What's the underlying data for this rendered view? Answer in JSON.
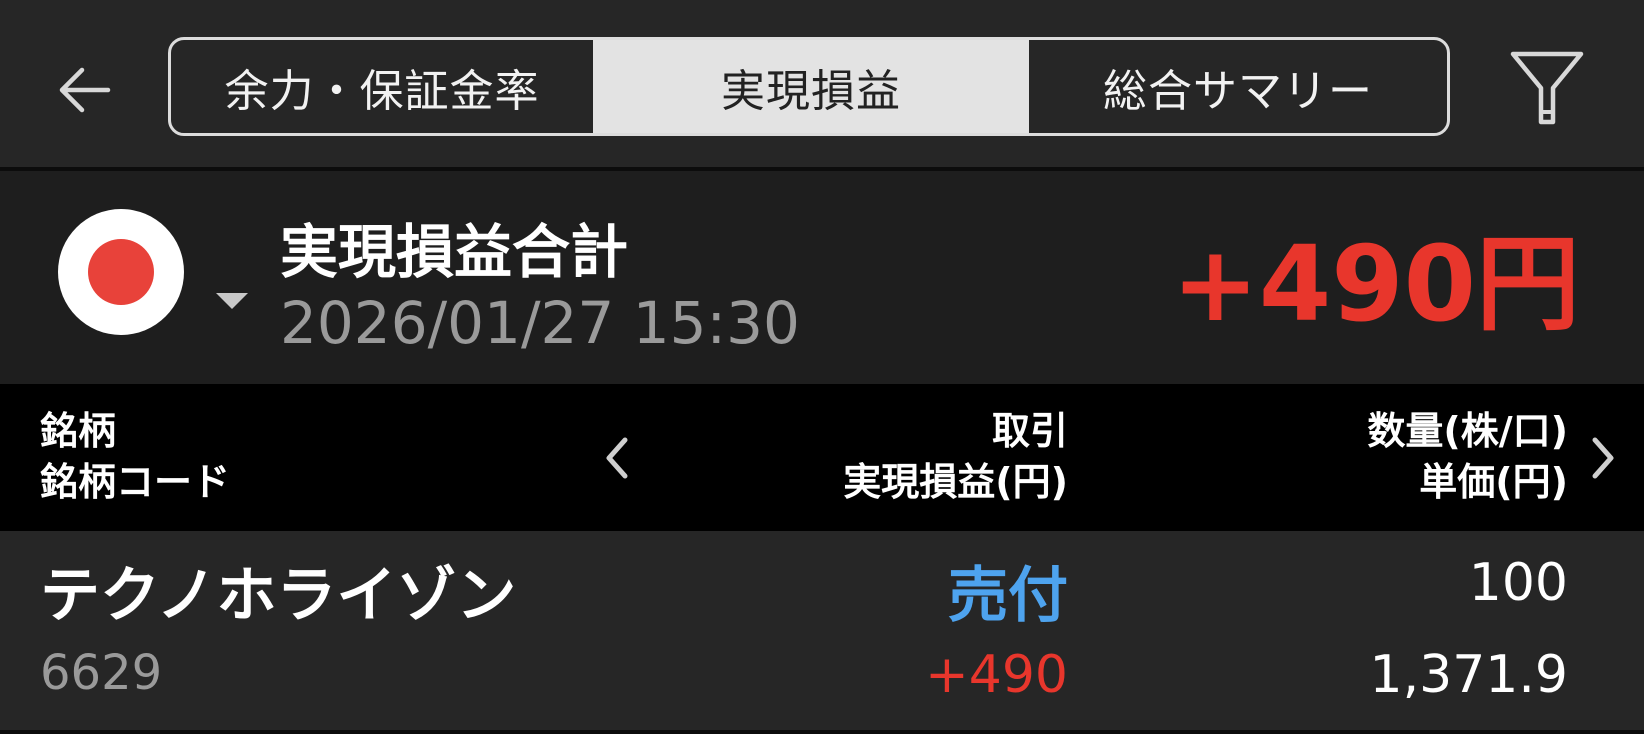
{
  "header": {
    "tabs": [
      {
        "label": "余力・保証金率",
        "selected": false
      },
      {
        "label": "実現損益",
        "selected": true
      },
      {
        "label": "総合サマリー",
        "selected": false
      }
    ],
    "back_icon": "arrow-left-icon",
    "filter_icon": "filter-icon"
  },
  "summary": {
    "market_icon": "japan-flag-icon",
    "title": "実現損益合計",
    "datetime": "2026/01/27  15:30",
    "total": "+490円"
  },
  "table": {
    "columns": {
      "col1": [
        "銘柄",
        "銘柄コード"
      ],
      "col2": [
        "取引",
        "実現損益(円)"
      ],
      "col3": [
        "数量(株/口)",
        "単価(円)"
      ]
    },
    "rows": [
      {
        "name": "テクノホライゾン",
        "code": "6629",
        "trade": "売付",
        "pl": "+490",
        "qty": "100",
        "price": "1,371.9"
      }
    ]
  },
  "colors": {
    "background": "#1e1e1e",
    "bar": "#262626",
    "header_bg": "#000000",
    "selected_tab": "#e3e3e3",
    "positive_red": "#e8362c",
    "sell_blue": "#4ea3ee",
    "muted_text": "#9a9a9a"
  }
}
